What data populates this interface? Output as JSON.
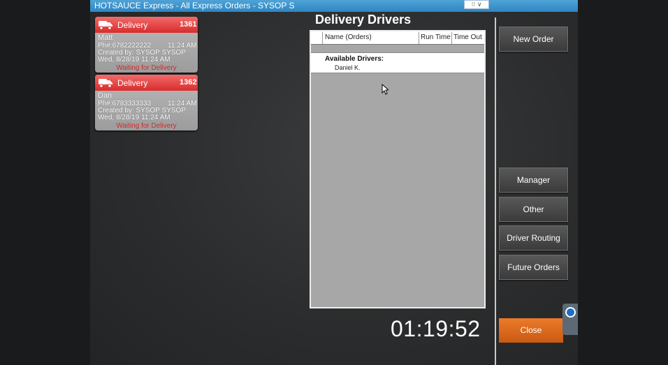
{
  "window": {
    "title": "HOTSAUCE Express - All Express Orders - SYSOP S",
    "controls": "⁝⁝ ∨"
  },
  "orders": [
    {
      "type": "Delivery",
      "number": "1361",
      "customer": "Matt",
      "phone": "Ph#:6782222222",
      "time": "11:24 AM",
      "created_by": "Created by: SYSOP SYSOP",
      "date": "Wed, 8/28/19 11:24 AM",
      "status": "Waiting for Delivery"
    },
    {
      "type": "Delivery",
      "number": "1362",
      "customer": "Dan",
      "phone": "Ph#:6783333333",
      "time": "11:24 AM",
      "created_by": "Created by: SYSOP SYSOP",
      "date": "Wed, 8/28/19 11:24 AM",
      "status": "Waiting for Delivery"
    }
  ],
  "screen_title": "Delivery Drivers",
  "table": {
    "columns": [
      "Name (Orders)",
      "Run Time",
      "Time Out"
    ],
    "available_label": "Available Drivers:",
    "drivers": [
      "Daniel K."
    ]
  },
  "buttons": {
    "new_order": "New Order",
    "manager": "Manager",
    "other": "Other",
    "driver_routing": "Driver Routing",
    "future_orders": "Future Orders",
    "close": "Close"
  },
  "clock": "01:19:52",
  "colors": {
    "accent_red": "#e03535",
    "close_orange": "#e06b1e",
    "title_blue": "#3d95cf"
  }
}
